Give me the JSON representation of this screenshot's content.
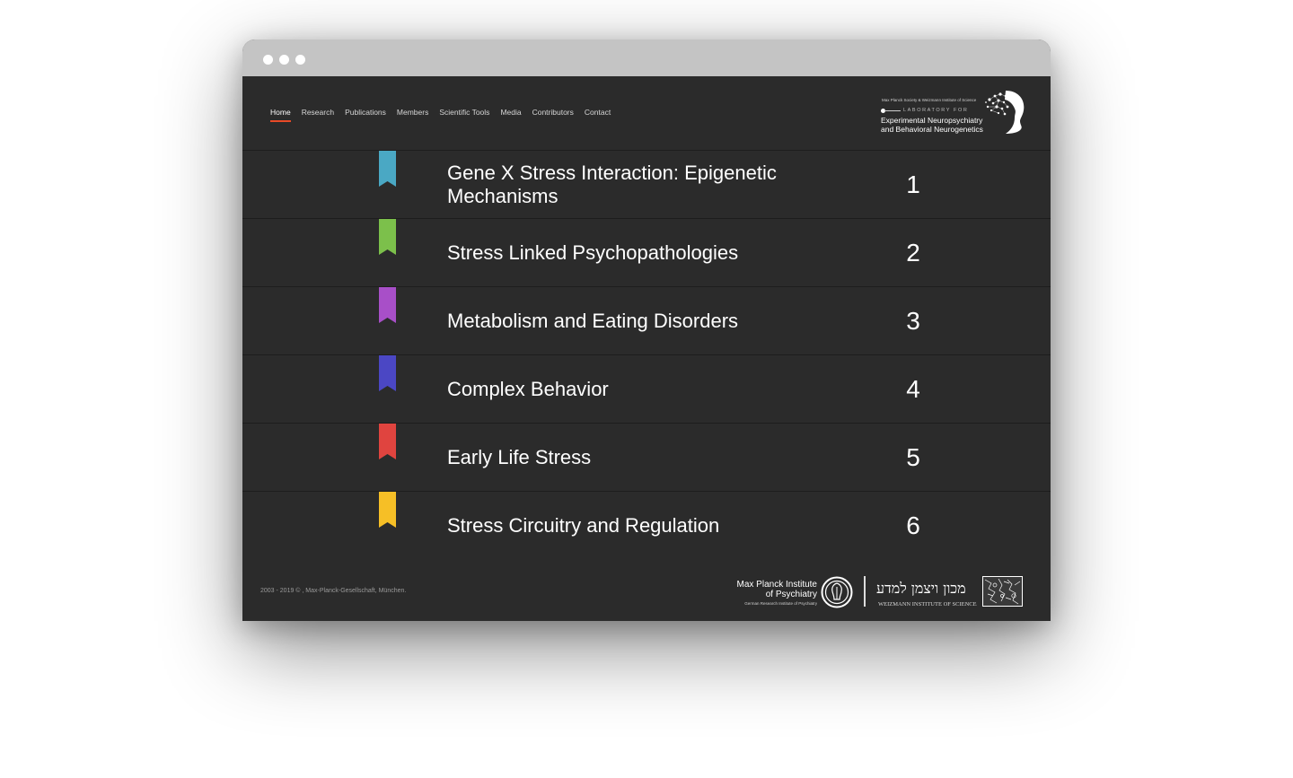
{
  "nav": {
    "items": [
      {
        "label": "Home",
        "active": true
      },
      {
        "label": "Research",
        "active": false
      },
      {
        "label": "Publications",
        "active": false
      },
      {
        "label": "Members",
        "active": false
      },
      {
        "label": "Scientific Tools",
        "active": false
      },
      {
        "label": "Media",
        "active": false
      },
      {
        "label": "Contributors",
        "active": false
      },
      {
        "label": "Contact",
        "active": false
      }
    ],
    "active_color": "#e84a27"
  },
  "logo": {
    "top_line": "Max Planck Society & Weizmann Institute of Science",
    "lab_for": "LABORATORY FOR",
    "name_line1": "Experimental Neuropsychiatry",
    "name_line2": "and Behavioral Neurogenetics",
    "icon": "brain-head-icon"
  },
  "research": [
    {
      "title": "Gene X Stress Interaction: Epigenetic Mechanisms",
      "number": "1",
      "color": "#4aa8c4"
    },
    {
      "title": "Stress Linked Psychopathologies",
      "number": "2",
      "color": "#7cc04b"
    },
    {
      "title": "Metabolism and Eating Disorders",
      "number": "3",
      "color": "#a84fc8"
    },
    {
      "title": "Complex Behavior",
      "number": "4",
      "color": "#4b47c4"
    },
    {
      "title": "Early Life Stress",
      "number": "5",
      "color": "#e0443f"
    },
    {
      "title": "Stress Circuitry and Regulation",
      "number": "6",
      "color": "#f6bf26"
    }
  ],
  "footer": {
    "copyright": "2003 - 2019 © , Max-Planck-Gesellschaft, München.",
    "mpi_line1": "Max Planck Institute",
    "mpi_line2": "of Psychiatry",
    "mpi_sub": "German Research Institute of Psychiatry",
    "weizmann_hebrew": "מכון ויצמן למדע",
    "weizmann_english": "WEIZMANN INSTITUTE OF SCIENCE"
  }
}
